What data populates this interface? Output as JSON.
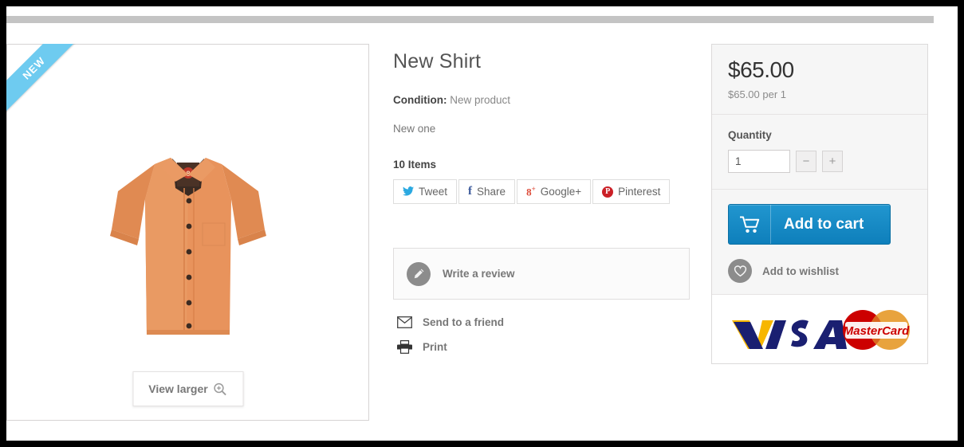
{
  "product": {
    "title": "New Shirt",
    "condition_label": "Condition:",
    "condition_value": "New product",
    "short_description": "New one",
    "stock": "10 Items",
    "badge": "NEW",
    "view_larger": "View larger",
    "image_alt": "orange-short-sleeve-shirt"
  },
  "social": [
    {
      "label": "Tweet",
      "icon": "twitter-icon",
      "glyph": "❇",
      "color": "#2ba9e1"
    },
    {
      "label": "Share",
      "icon": "facebook-icon",
      "glyph": "f",
      "color": "#3a589a"
    },
    {
      "label": "Google+",
      "icon": "googleplus-icon",
      "glyph": "8⁺",
      "color": "#dd4b39"
    },
    {
      "label": "Pinterest",
      "icon": "pinterest-icon",
      "glyph": "P",
      "color": "#cb2027"
    }
  ],
  "actions": {
    "write_review": "Write a review",
    "send_to_friend": "Send to a friend",
    "print": "Print"
  },
  "buy": {
    "price": "$65.00",
    "price_per_unit": "$65.00 per 1",
    "quantity_label": "Quantity",
    "quantity_value": "1",
    "minus": "−",
    "plus": "+",
    "add_to_cart": "Add to cart",
    "add_to_wishlist": "Add to wishlist",
    "payment_methods": [
      "VISA",
      "MasterCard"
    ]
  },
  "colors": {
    "accent_blue": "#0e7fbb",
    "badge_blue": "#6ecbf0",
    "panel_bg": "#f6f6f6",
    "text_muted": "#777777",
    "visa_blue": "#1a1f71",
    "visa_gold": "#f7b600",
    "mc_red": "#cc0000",
    "mc_orange": "#e8a33d"
  }
}
